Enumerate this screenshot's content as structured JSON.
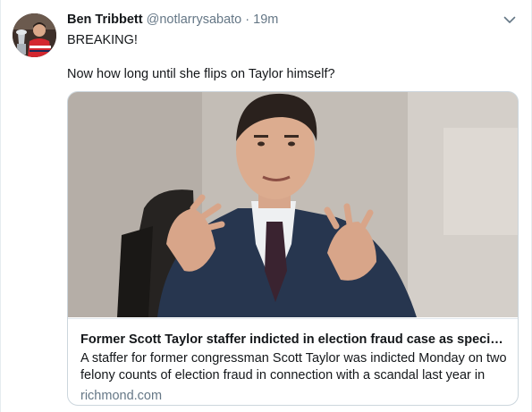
{
  "tweet": {
    "author_name": "Ben Tribbett",
    "handle": "@notlarrysabato",
    "separator": "·",
    "time": "19m",
    "lines": [
      "BREAKING!",
      "Now how long until she flips on Taylor himself?"
    ]
  },
  "card": {
    "title": "Former Scott Taylor staffer indicted in election fraud case as special ...",
    "description": "A staffer for former congressman Scott Taylor was indicted Monday on two felony counts of election fraud in connection with a scandal last year in",
    "domain": "richmond.com"
  },
  "icons": {
    "menu": "chevron-down-icon",
    "avatar": "avatar-image"
  },
  "colors": {
    "text": "#14171a",
    "secondary": "#657786",
    "border": "#ccd6dd",
    "avatar_jersey": "#d3272f"
  }
}
